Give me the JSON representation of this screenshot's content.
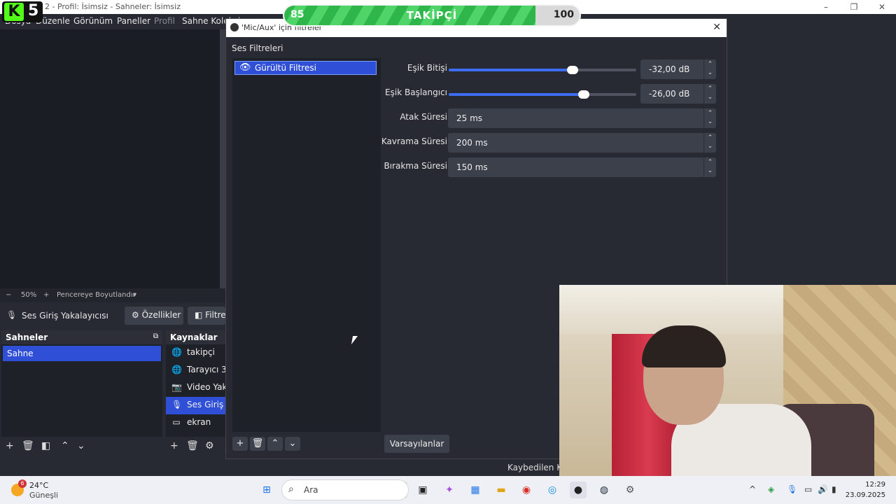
{
  "obs": {
    "window_title": "2 - Profil: İsimsiz - Sahneler: İsimsiz",
    "menu": [
      "Dosya",
      "Düzenle",
      "Görünüm",
      "Paneller",
      "Profil",
      "Sahne Koleksiyonu"
    ],
    "zoom": "50%",
    "fit_label": "Pencereye Boyutlandır",
    "selected_source": "Ses Giriş Yakalayıcısı",
    "properties_button": "Özellikler",
    "filters_button": "Filtreler",
    "scenes_title": "Sahneler",
    "scenes": [
      "Sahne"
    ],
    "sources_title": "Kaynaklar",
    "sources": [
      {
        "label": "takipçi",
        "icon": "globe-icon"
      },
      {
        "label": "Tarayıcı 3",
        "icon": "globe-icon"
      },
      {
        "label": "Video Yakalama",
        "icon": "camera-icon"
      },
      {
        "label": "Ses Giriş Yakalayıcısı",
        "icon": "mic-icon"
      },
      {
        "label": "ekran",
        "icon": "monitor-icon"
      }
    ],
    "status_text": "Kaybedilen Kareler"
  },
  "dialog": {
    "title": "'Mic/Aux' için filtreler",
    "section": "Ses Filtreleri",
    "filter_name": "Gürültü Filtresi",
    "defaults_button": "Varsayılanlar",
    "params": {
      "close_label": "Eşik Bitişi",
      "close_value": "-32,00 dB",
      "close_level": 0.66,
      "open_label": "Eşik Başlangıcı",
      "open_value": "-26,00 dB",
      "open_level": 0.72,
      "attack_label": "Atak Süresi",
      "attack_value": "25 ms",
      "hold_label": "Kavrama Süresi",
      "hold_value": "200 ms",
      "release_label": "Bırakma Süresi",
      "release_value": "150 ms"
    }
  },
  "overlay": {
    "logo_letter": "K",
    "logo_number": "5",
    "follower_current": "85",
    "follower_label": "TAKİPÇİ",
    "follower_goal": "100",
    "follower_progress": 0.85
  },
  "taskbar": {
    "weather_badge": "6",
    "temperature": "24°C",
    "condition": "Güneşli",
    "search_placeholder": "Ara",
    "time": "12:29",
    "date": "23.09.2025"
  }
}
